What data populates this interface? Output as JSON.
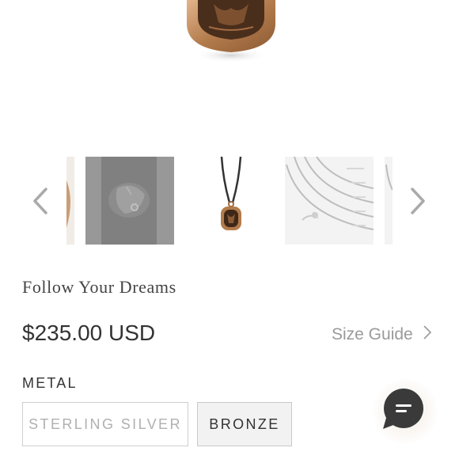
{
  "product": {
    "title": "Follow Your Dreams",
    "price": "$235.00 USD",
    "size_guide_label": "Size Guide"
  },
  "gallery": {
    "thumbnails": [
      {
        "name": "thumbnail-partial-left"
      },
      {
        "name": "thumbnail-hand-selected"
      },
      {
        "name": "thumbnail-pendant-necklace"
      },
      {
        "name": "thumbnail-chain-lengths"
      },
      {
        "name": "thumbnail-partial-right"
      }
    ],
    "prev_icon": "chevron-left-icon",
    "next_icon": "chevron-right-icon"
  },
  "options": {
    "label": "METAL",
    "values": [
      "STERLING SILVER",
      "BRONZE"
    ],
    "selected": "BRONZE"
  },
  "chat": {
    "icon": "chat-bubble-icon"
  },
  "colors": {
    "bronze": "#b07a4a",
    "text": "#333333",
    "muted": "#9a9a9a"
  }
}
